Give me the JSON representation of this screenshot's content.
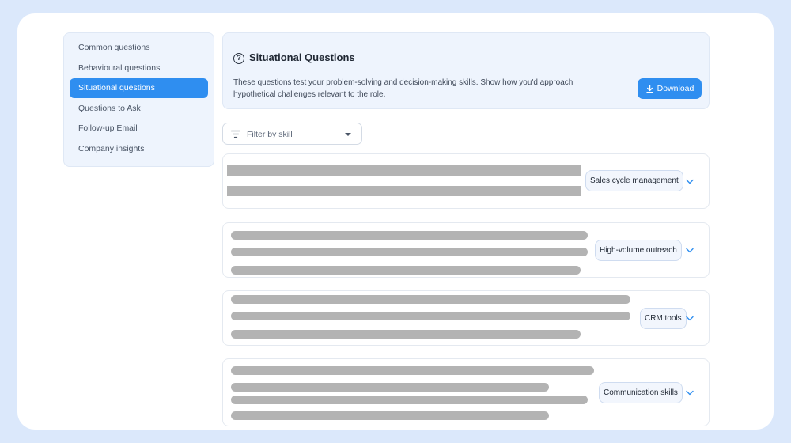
{
  "sidebar": {
    "items": [
      {
        "label": "Common questions",
        "active": false
      },
      {
        "label": "Behavioural questions",
        "active": false
      },
      {
        "label": "Situational questions",
        "active": true
      },
      {
        "label": "Questions to Ask",
        "active": false
      },
      {
        "label": "Follow-up Email",
        "active": false
      },
      {
        "label": "Company insights",
        "active": false
      }
    ]
  },
  "header": {
    "icon": "question-circle-icon",
    "title": "Situational Questions",
    "description": "These questions test your problem-solving and decision-making skills. Show how you'd approach hypothetical challenges relevant to the role.",
    "download_label": "Download"
  },
  "filter": {
    "placeholder": "Filter by skill"
  },
  "questions": [
    {
      "skill": "Sales cycle management",
      "text": "",
      "obscured": true
    },
    {
      "skill": "High-volume outreach",
      "text": "",
      "obscured": true
    },
    {
      "skill": "CRM tools",
      "text": "",
      "obscured": true
    },
    {
      "skill": "Communication skills",
      "text": "",
      "obscured": true
    }
  ],
  "colors": {
    "accent": "#2f8ef0",
    "panel": "#eef4fd",
    "backdrop": "#dbe8fb"
  }
}
